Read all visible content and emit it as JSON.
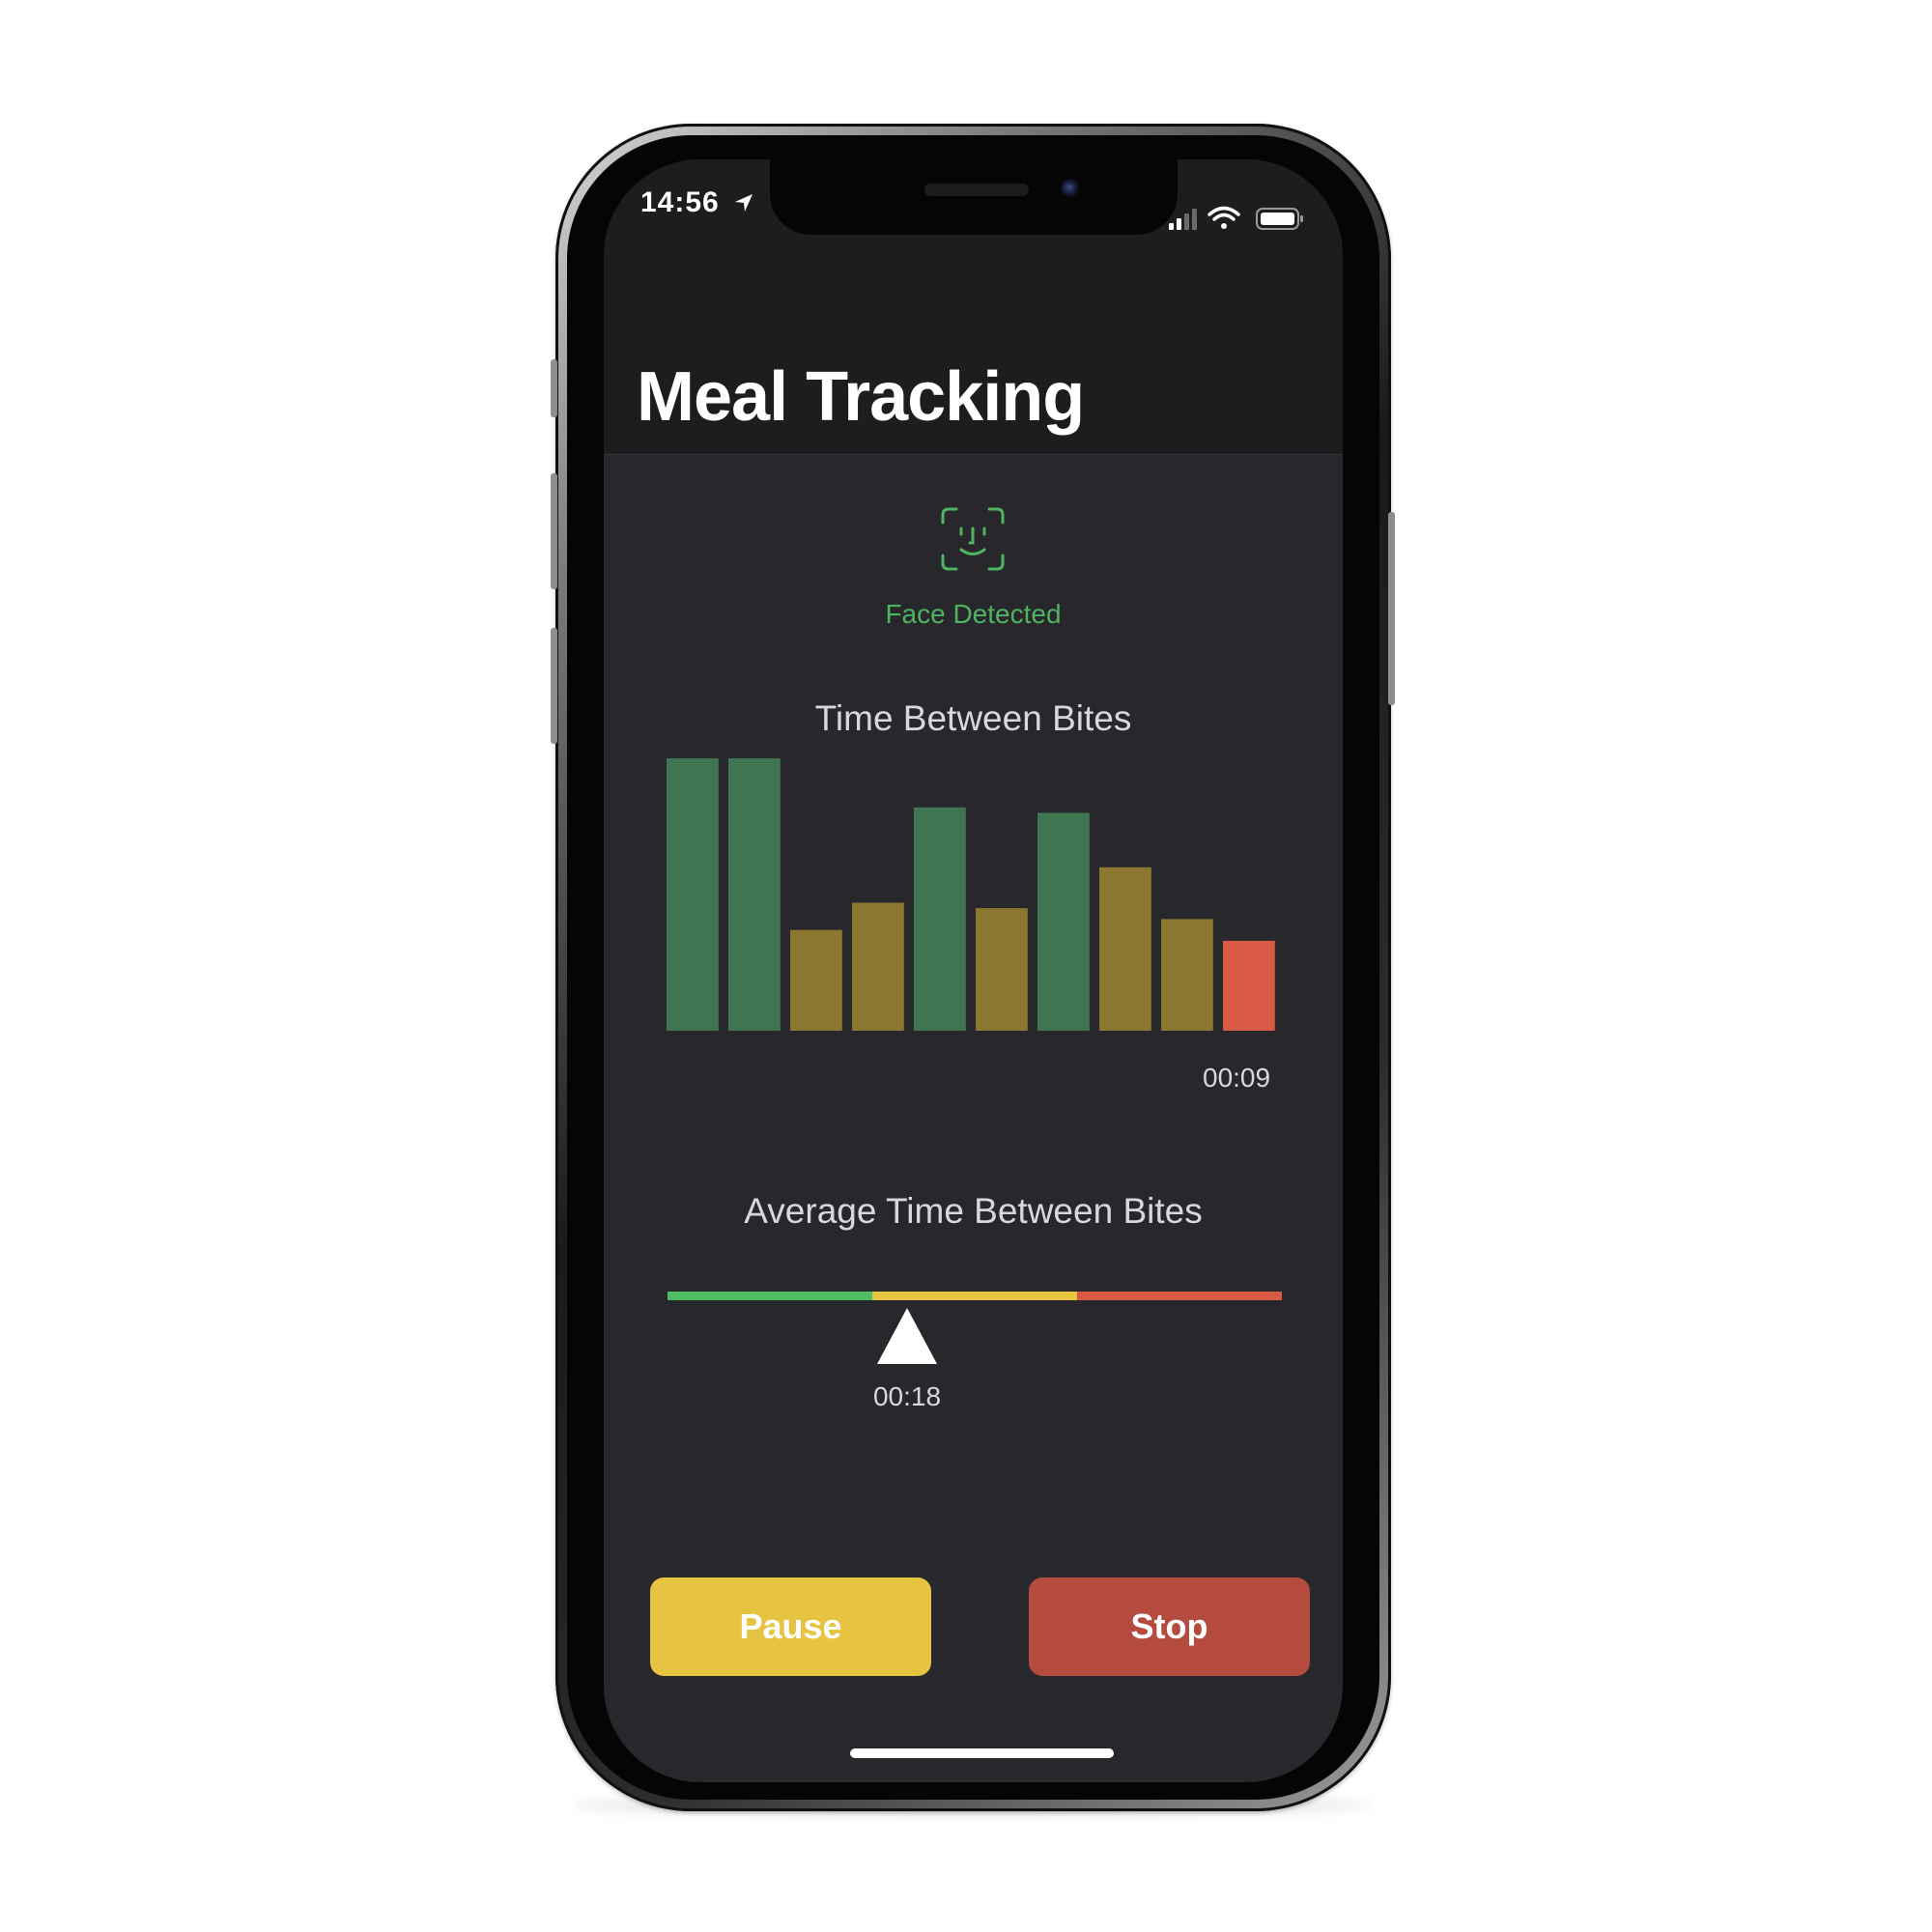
{
  "status_bar": {
    "time": "14:56",
    "location_icon": "location-arrow-icon",
    "signal_icon": "cellular-signal-icon",
    "wifi_icon": "wifi-icon",
    "battery_icon": "battery-icon"
  },
  "header": {
    "title": "Meal Tracking"
  },
  "face_status": {
    "icon": "face-id-icon",
    "label": "Face Detected",
    "color": "#4fb361"
  },
  "chart_data": {
    "type": "bar",
    "title": "Time Between Bites",
    "values": [
      100,
      100,
      37,
      47,
      82,
      45,
      80,
      60,
      41,
      33
    ],
    "colors": [
      "#3f7651",
      "#3f7651",
      "#8c7731",
      "#8c7731",
      "#3f7651",
      "#8c7731",
      "#3f7651",
      "#8c7731",
      "#8c7731",
      "#d95a45"
    ],
    "latest_label": "00:09"
  },
  "average": {
    "title": "Average Time Between Bites",
    "value_label": "00:18",
    "position_fraction": 0.39,
    "segment_colors": [
      "#4fbf65",
      "#e5c43f",
      "#d95a45"
    ]
  },
  "buttons": {
    "pause_label": "Pause",
    "stop_label": "Stop"
  }
}
